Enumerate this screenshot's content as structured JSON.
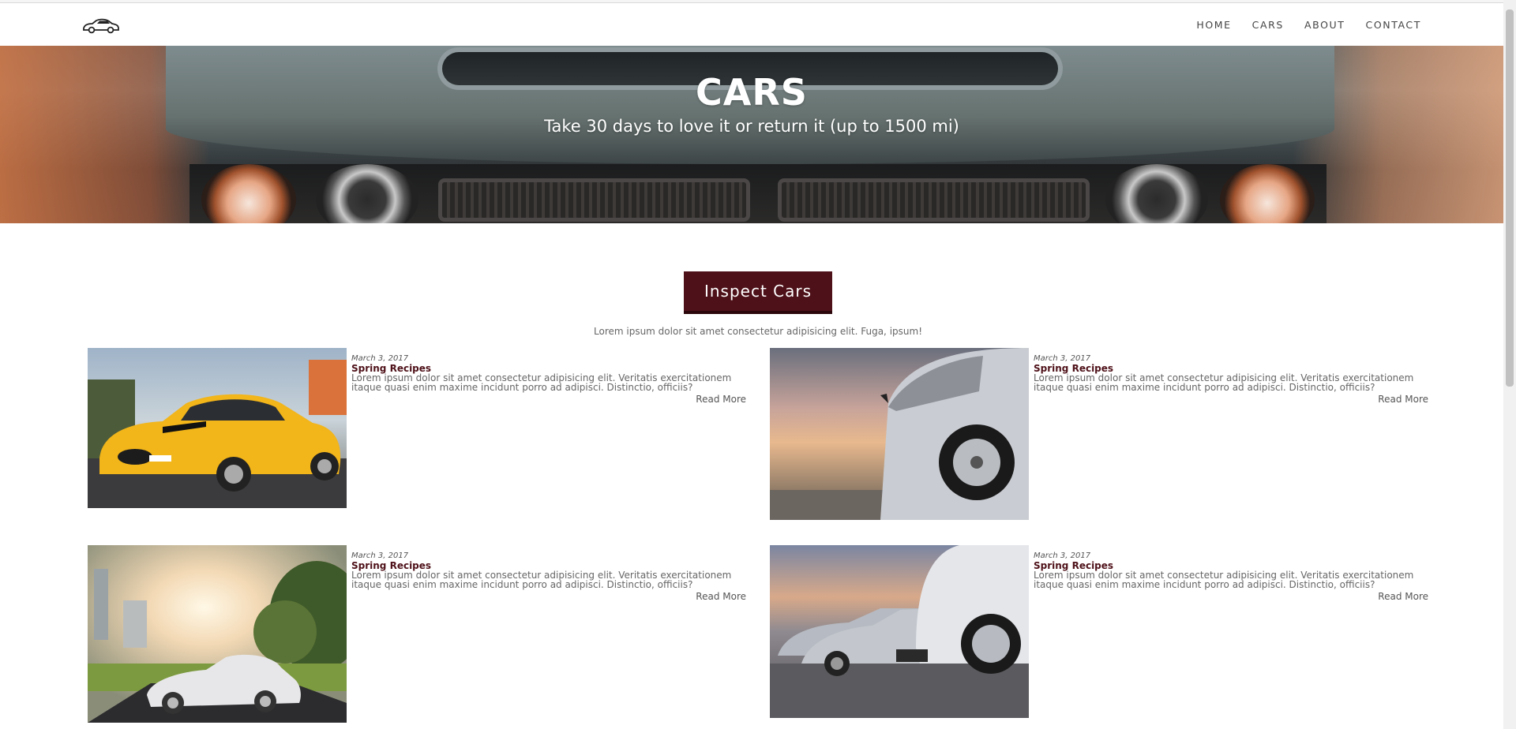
{
  "nav": {
    "logo": "car-logo-icon",
    "links": [
      "HOME",
      "CARS",
      "ABOUT",
      "CONTACT"
    ]
  },
  "hero": {
    "title": "CARS",
    "subtitle": "Take 30 days to love it or return it (up to 1500 mi)"
  },
  "cta": {
    "label": "Inspect Cars"
  },
  "intro": "Lorem ipsum dolor sit amet consectetur adipisicing elit. Fuga, ipsum!",
  "cards": [
    {
      "date": "March 3, 2017",
      "title": "Spring Recipes",
      "text": "Lorem ipsum dolor sit amet consectetur adipisicing elit. Veritatis exercitationem itaque quasi enim maxime incidunt porro ad adipisci. Distinctio, officiis?",
      "read_more": "Read More",
      "image": "yellow-sports-car"
    },
    {
      "date": "March 3, 2017",
      "title": "Spring Recipes",
      "text": "Lorem ipsum dolor sit amet consectetur adipisicing elit. Veritatis exercitationem itaque quasi enim maxime incidunt porro ad adipisci. Distinctio, officiis?",
      "read_more": "Read More",
      "image": "silver-car-side-sunset"
    },
    {
      "date": "March 3, 2017",
      "title": "Spring Recipes",
      "text": "Lorem ipsum dolor sit amet consectetur adipisicing elit. Veritatis exercitationem itaque quasi enim maxime incidunt porro ad adipisci. Distinctio, officiis?",
      "read_more": "Read More",
      "image": "white-sports-car-park"
    },
    {
      "date": "March 3, 2017",
      "title": "Spring Recipes",
      "text": "Lorem ipsum dolor sit amet consectetur adipisicing elit. Veritatis exercitationem itaque quasi enim maxime incidunt porro ad adipisci. Distinctio, officiis?",
      "read_more": "Read More",
      "image": "parked-cars-sunset"
    }
  ],
  "colors": {
    "accent": "#4e1119",
    "text": "#555555"
  }
}
